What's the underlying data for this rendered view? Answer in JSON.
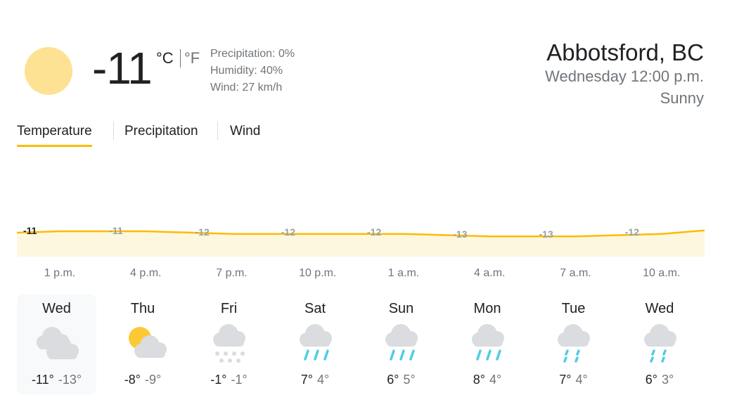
{
  "current": {
    "condition_icon": "sunny-icon",
    "temp": "-11",
    "unit_c": "°C",
    "unit_f": "°F",
    "precipitation": "Precipitation: 0%",
    "humidity": "Humidity: 40%",
    "wind": "Wind: 27 km/h"
  },
  "location": {
    "name": "Abbotsford, BC",
    "datetime": "Wednesday 12:00 p.m.",
    "condition": "Sunny"
  },
  "tabs": [
    {
      "label": "Temperature",
      "active": true
    },
    {
      "label": "Precipitation",
      "active": false
    },
    {
      "label": "Wind",
      "active": false
    }
  ],
  "colors": {
    "accent": "#fbbc04",
    "sun": "#fde293",
    "cloud": "#dadce0",
    "rain": "#4ecde6"
  },
  "chart_data": {
    "type": "area",
    "x": [
      "1 p.m.",
      "4 p.m.",
      "7 p.m.",
      "10 p.m.",
      "1 a.m.",
      "4 a.m.",
      "7 a.m.",
      "10 a.m."
    ],
    "values": [
      -11,
      -11,
      -12,
      -12,
      -12,
      -13,
      -13,
      -12
    ],
    "value_labels": [
      "-11",
      "-11",
      "-12",
      "-12",
      "-12",
      "-13",
      "-13",
      "-12"
    ],
    "ylim": [
      -20,
      -5
    ]
  },
  "days": [
    {
      "name": "Wed",
      "icon": "cloudy-icon",
      "high": "-11°",
      "low": "-13°",
      "selected": true
    },
    {
      "name": "Thu",
      "icon": "partly-cloudy-icon",
      "high": "-8°",
      "low": "-9°",
      "selected": false
    },
    {
      "name": "Fri",
      "icon": "snow-icon",
      "high": "-1°",
      "low": "-1°",
      "selected": false
    },
    {
      "name": "Sat",
      "icon": "rain-icon",
      "high": "7°",
      "low": "4°",
      "selected": false
    },
    {
      "name": "Sun",
      "icon": "rain-icon",
      "high": "6°",
      "low": "5°",
      "selected": false
    },
    {
      "name": "Mon",
      "icon": "rain-icon",
      "high": "8°",
      "low": "4°",
      "selected": false
    },
    {
      "name": "Tue",
      "icon": "light-rain-icon",
      "high": "7°",
      "low": "4°",
      "selected": false
    },
    {
      "name": "Wed",
      "icon": "light-rain-icon",
      "high": "6°",
      "low": "3°",
      "selected": false
    }
  ]
}
